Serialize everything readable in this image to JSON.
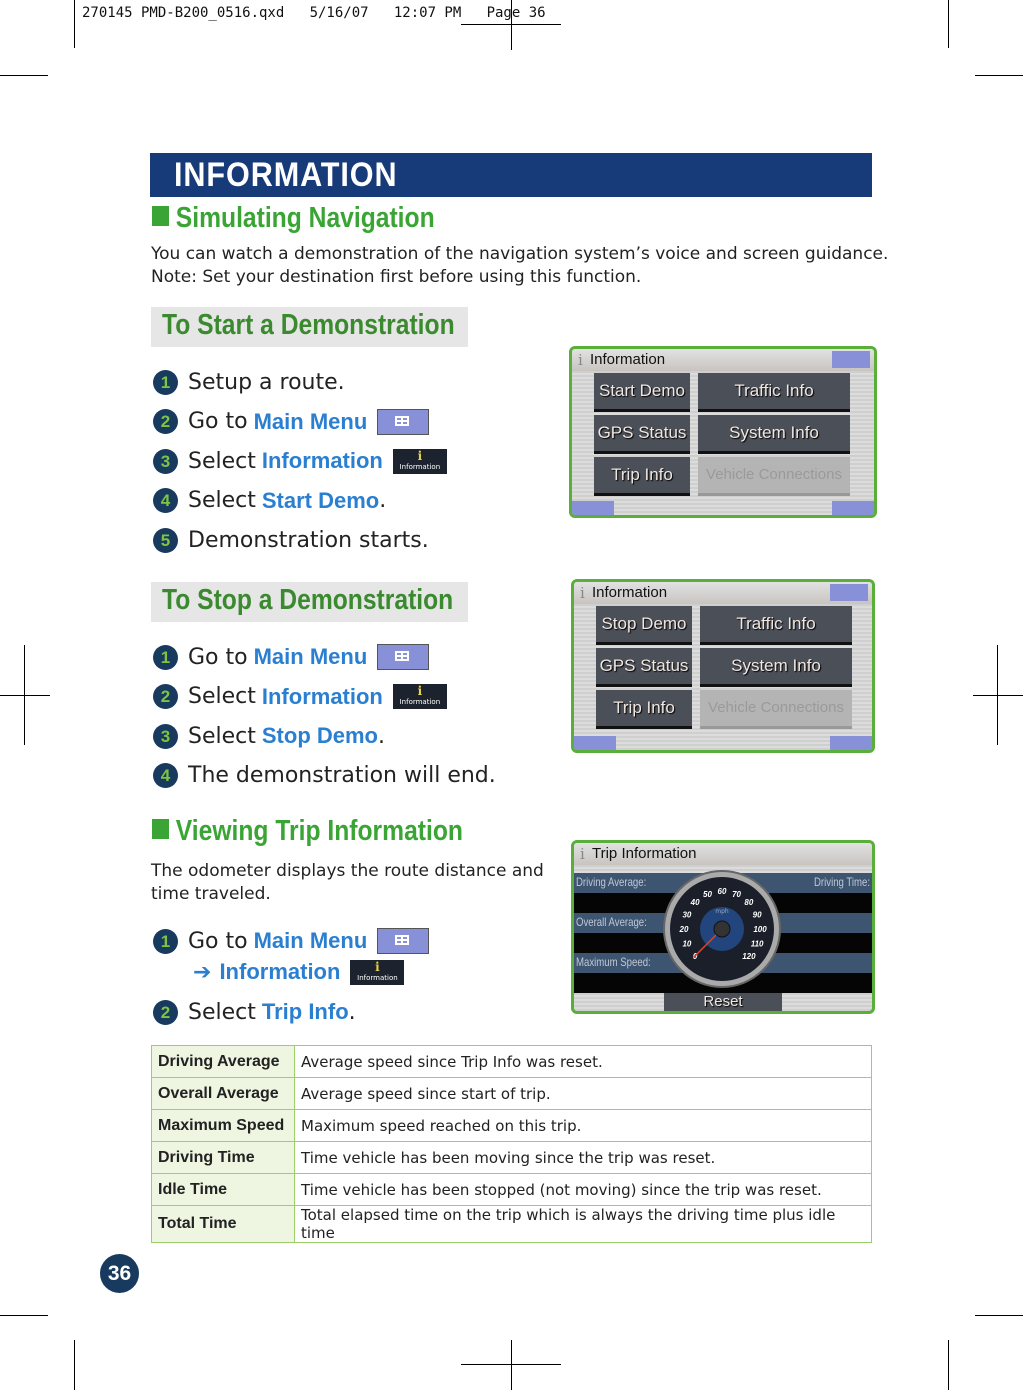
{
  "slug": "270145 PMD-B200_0516.qxd   5/16/07   12:07 PM   Page 36",
  "header": "INFORMATION",
  "section1": {
    "title": "Simulating Navigation",
    "text1": "You can watch a demonstration of the navigation system’s voice and screen guidance.",
    "text2": "Note: Set your destination first before using this function."
  },
  "start": {
    "title": "To Start a Demonstration",
    "steps": [
      {
        "n": "1",
        "pre": "Setup a route.",
        "hl": "",
        "post": ""
      },
      {
        "n": "2",
        "pre": "Go to",
        "hl": "Main Menu",
        "post": ""
      },
      {
        "n": "3",
        "pre": "Select",
        "hl": "Information",
        "post": ""
      },
      {
        "n": "4",
        "pre": "Select",
        "hl": "Start Demo",
        "post": "."
      },
      {
        "n": "5",
        "pre": "Demonstration starts.",
        "hl": "",
        "post": ""
      }
    ]
  },
  "stop": {
    "title": "To Stop a Demonstration",
    "steps": [
      {
        "n": "1",
        "pre": "Go to",
        "hl": "Main Menu",
        "post": ""
      },
      {
        "n": "2",
        "pre": "Select",
        "hl": "Information",
        "post": ""
      },
      {
        "n": "3",
        "pre": "Select",
        "hl": "Stop Demo",
        "post": "."
      },
      {
        "n": "4",
        "pre": "The demonstration will end.",
        "hl": "",
        "post": ""
      }
    ]
  },
  "icon_info_label": "Information",
  "icon_info_glyph": "i",
  "screen1": {
    "title": "Information",
    "buttons": [
      "Start Demo",
      "Traffic Info",
      "GPS Status",
      "System Info",
      "Trip Info",
      "Vehicle Connections"
    ]
  },
  "screen2": {
    "title": "Information",
    "buttons": [
      "Stop Demo",
      "Traffic Info",
      "GPS Status",
      "System Info",
      "Trip Info",
      "Vehicle Connections"
    ]
  },
  "section2": {
    "title": "Viewing Trip Information",
    "text1": "The odometer displays the route distance and",
    "text2": "time traveled.",
    "steps": [
      {
        "n": "1",
        "pre": "Go to",
        "hl": "Main Menu"
      },
      {
        "arrow": "➔",
        "hl": "Information"
      },
      {
        "n": "2",
        "pre": "Select",
        "hl": "Trip Info",
        "post": "."
      }
    ]
  },
  "trip_screen": {
    "title": "Trip Information",
    "driving_average": "Driving Average:",
    "overall_average": "Overall Average:",
    "maximum_speed": "Maximum Speed:",
    "driving_time": "Driving Time:",
    "reset": "Reset",
    "gauge_unit": "mph",
    "gauge_ticks": [
      "0",
      "10",
      "20",
      "30",
      "40",
      "50",
      "60",
      "70",
      "80",
      "90",
      "100",
      "110",
      "120"
    ]
  },
  "table": [
    [
      "Driving Average",
      "Average speed since Trip Info was reset."
    ],
    [
      "Overall Average",
      "Average speed since start of trip."
    ],
    [
      "Maximum Speed",
      "Maximum speed reached on this trip."
    ],
    [
      "Driving Time",
      "Time vehicle has been moving since the trip was reset."
    ],
    [
      "Idle Time",
      "Time vehicle has been stopped (not moving) since the trip was reset."
    ],
    [
      "Total Time",
      "Total elapsed time on the trip which is always the driving time plus idle time"
    ]
  ],
  "page_number": "36",
  "colors": {
    "header": "#173a78",
    "green": "#3aa535",
    "highlight": "#2a7fd0"
  }
}
